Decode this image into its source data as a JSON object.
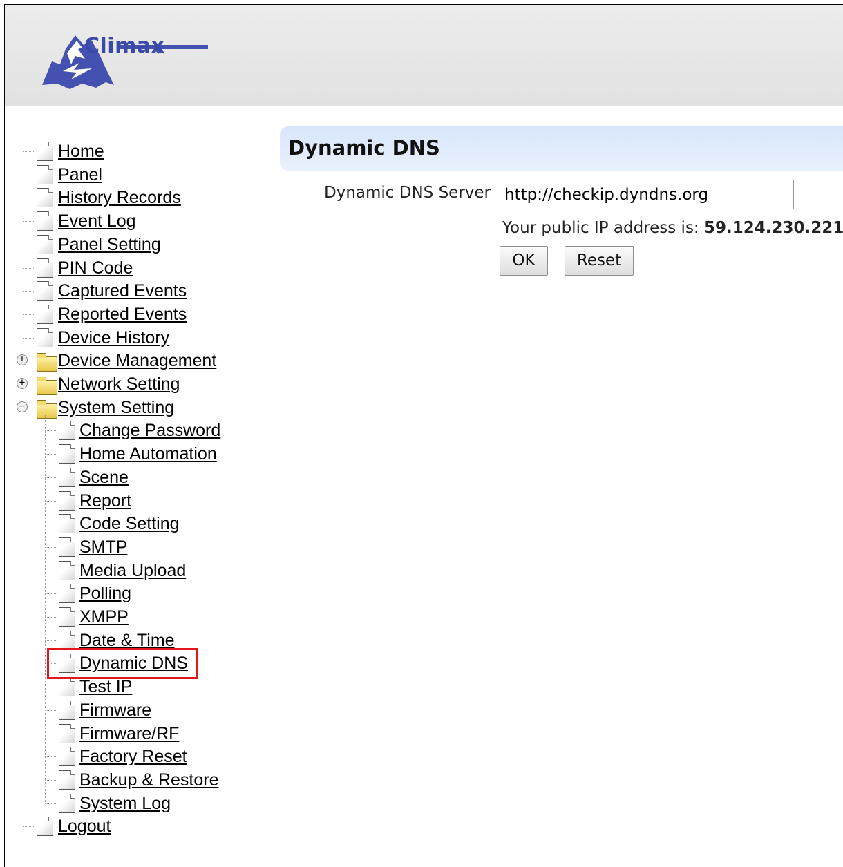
{
  "header": {
    "logo_text": "Climax"
  },
  "nav": {
    "top_items": [
      {
        "label": "Home",
        "type": "page"
      },
      {
        "label": "Panel",
        "type": "page"
      },
      {
        "label": "History Records",
        "type": "page"
      },
      {
        "label": "Event Log",
        "type": "page"
      },
      {
        "label": "Panel Setting",
        "type": "page"
      },
      {
        "label": "PIN Code",
        "type": "page"
      },
      {
        "label": "Captured Events",
        "type": "page"
      },
      {
        "label": "Reported Events",
        "type": "page"
      },
      {
        "label": "Device History",
        "type": "page"
      },
      {
        "label": "Device Management",
        "type": "folder",
        "expanded": false
      },
      {
        "label": "Network Setting",
        "type": "folder",
        "expanded": false
      },
      {
        "label": "System Setting",
        "type": "folder",
        "expanded": true
      }
    ],
    "system_setting_children": [
      "Change Password",
      "Home Automation",
      "Scene",
      "Report",
      "Code Setting",
      "SMTP",
      "Media Upload",
      "Polling",
      "XMPP",
      "Date & Time",
      "Dynamic DNS",
      "Test IP",
      "Firmware",
      "Firmware/RF",
      "Factory Reset",
      "Backup & Restore",
      "System Log"
    ],
    "bottom_items": [
      {
        "label": "Logout",
        "type": "page"
      }
    ],
    "selected": "Dynamic DNS",
    "highlight_color": "#e3161b"
  },
  "content": {
    "title": "Dynamic DNS",
    "server_label": "Dynamic DNS Server",
    "server_value": "http://checkip.dyndns.org",
    "ip_prefix": "Your public IP address is:",
    "ip_value": "59.124.230.221",
    "ok_label": "OK",
    "reset_label": "Reset"
  },
  "colors": {
    "title_bar": "#dbe8fb",
    "brand": "#3b4aa8"
  }
}
